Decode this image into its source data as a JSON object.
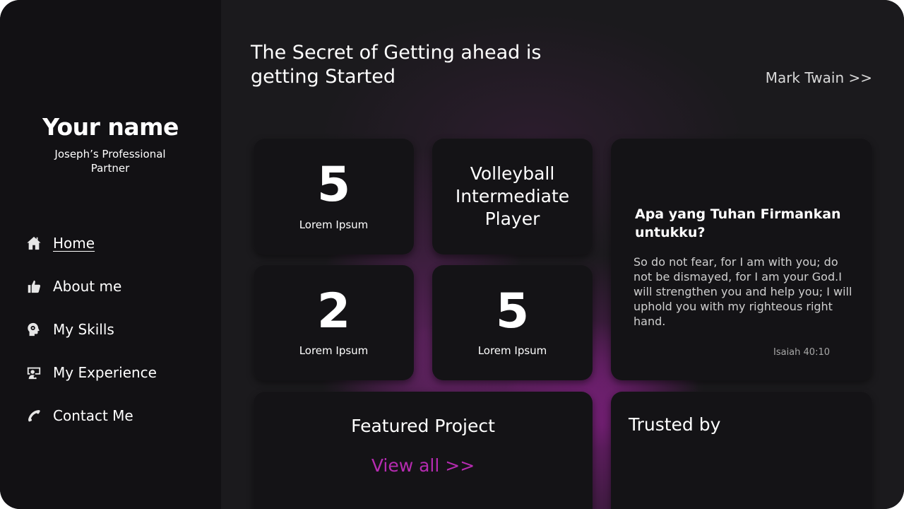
{
  "sidebar": {
    "name": "Your name",
    "subtitle": "Joseph’s Professional Partner",
    "nav": [
      {
        "label": "Home",
        "icon": "home-icon",
        "active": true
      },
      {
        "label": "About me",
        "icon": "thumbs-up-icon",
        "active": false
      },
      {
        "label": "My Skills",
        "icon": "brain-gear-icon",
        "active": false
      },
      {
        "label": "My Experience",
        "icon": "graduate-icon",
        "active": false
      },
      {
        "label": "Contact Me",
        "icon": "phone-icon",
        "active": false
      }
    ]
  },
  "header": {
    "quote": "The Secret of Getting ahead is getting Started",
    "author_link": "Mark Twain >>"
  },
  "stats": [
    {
      "number": "5",
      "label": "Lorem Ipsum"
    },
    {
      "text": "Volleyball Intermediate Player"
    },
    {
      "number": "2",
      "label": "Lorem Ipsum"
    },
    {
      "number": "5",
      "label": "Lorem Ipsum"
    }
  ],
  "verse": {
    "title": "Apa yang Tuhan Firmankan untukku?",
    "body": "So do not fear, for I am with you; do not be dismayed, for I am your God.I will strengthen you and help you; I will uphold you with my righteous right hand.",
    "reference": "Isaiah 40:10"
  },
  "featured": {
    "title": "Featured Project",
    "view_all": "View all >>"
  },
  "trusted": {
    "title": "Trusted by"
  },
  "colors": {
    "background": "#1b1a1d",
    "sidebar": "#121114",
    "card": "#141316",
    "accent": "#b52bb0",
    "glow": "#9a2a9a"
  }
}
